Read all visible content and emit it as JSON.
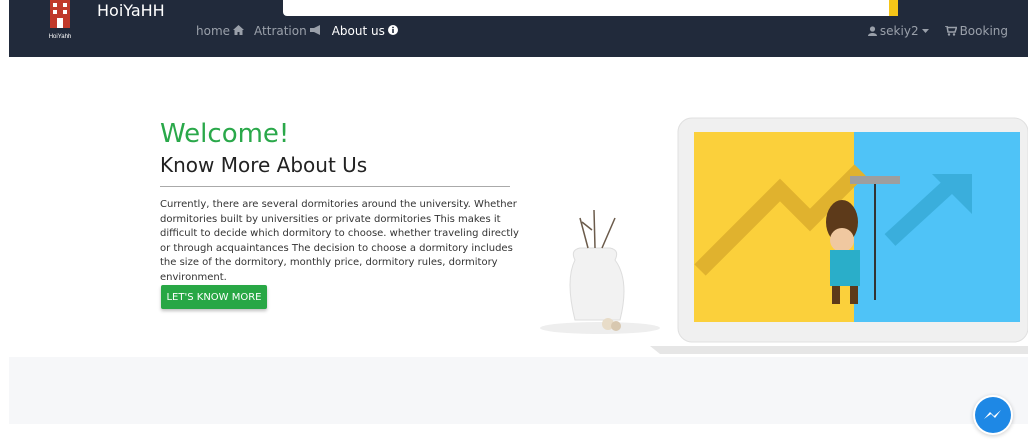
{
  "brand": {
    "name": "HoiYaHH",
    "logo_caption": "HoiYahh"
  },
  "nav": {
    "links": [
      {
        "label": "home",
        "icon": "home-icon"
      },
      {
        "label": "Attration",
        "icon": "megaphone-icon"
      },
      {
        "label": "About us",
        "icon": "info-icon"
      }
    ],
    "user": "sekiy2",
    "booking": "Booking"
  },
  "hero": {
    "title": "Welcome!",
    "subtitle": "Know More About Us",
    "description": "Currently, there are several dormitories around the university. Whether dormitories built by universities or private dormitories This makes it difficult to decide which dormitory to choose. whether traveling directly or through acquaintances The decision to choose a dormitory includes the size of the dormitory, monthly price, dormitory rules, dormitory environment.",
    "cta": "LET'S KNOW MORE"
  },
  "colors": {
    "nav_bg": "#212a3b",
    "green": "#2aa84a",
    "yellow": "#fbd03b",
    "blue": "#4fc3f7"
  }
}
